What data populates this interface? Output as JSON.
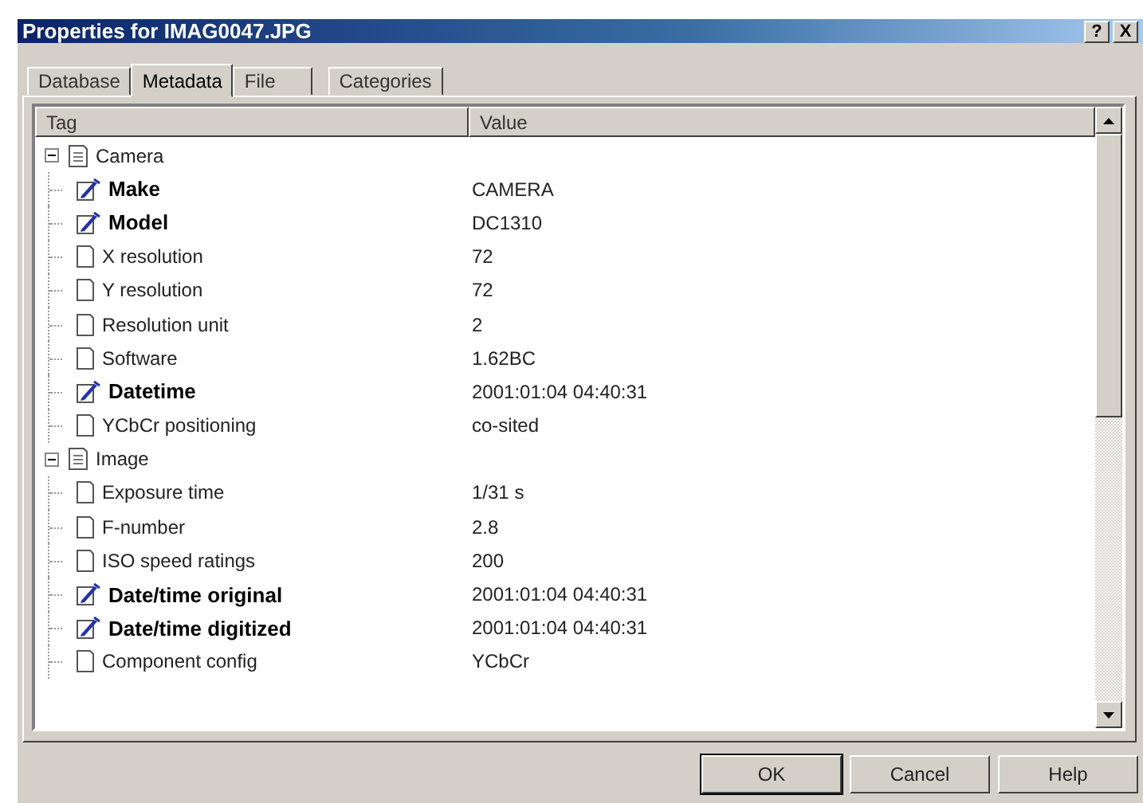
{
  "window": {
    "title": "Properties for IMAG0047.JPG",
    "help_glyph": "?",
    "close_glyph": "X"
  },
  "tabs": [
    {
      "label": "Database",
      "selected": false
    },
    {
      "label": "Metadata",
      "selected": true
    },
    {
      "label": "File",
      "selected": false
    },
    {
      "label": "Categories",
      "selected": false
    }
  ],
  "table": {
    "columns": [
      "Tag",
      "Value"
    ],
    "rows": [
      {
        "tag": "Camera",
        "expanded": true,
        "children": [
          {
            "tag": "Make",
            "value": "CAMERA",
            "modified": true
          },
          {
            "tag": "Model",
            "value": "DC1310",
            "modified": true
          },
          {
            "tag": "X resolution",
            "value": "72",
            "modified": false
          },
          {
            "tag": "Y resolution",
            "value": "72",
            "modified": false
          },
          {
            "tag": "Resolution unit",
            "value": "2",
            "modified": false
          },
          {
            "tag": "Software",
            "value": "1.62BC",
            "modified": false
          },
          {
            "tag": "Datetime",
            "value": "2001:01:04 04:40:31",
            "modified": true
          },
          {
            "tag": "YCbCr positioning",
            "value": "co-sited",
            "modified": false
          }
        ]
      },
      {
        "tag": "Image",
        "expanded": true,
        "children": [
          {
            "tag": "Exposure time",
            "value": "1/31 s",
            "modified": false
          },
          {
            "tag": "F-number",
            "value": "2.8",
            "modified": false
          },
          {
            "tag": "ISO speed ratings",
            "value": "200",
            "modified": false
          },
          {
            "tag": "Date/time original",
            "value": "2001:01:04 04:40:31",
            "modified": true
          },
          {
            "tag": "Date/time digitized",
            "value": "2001:01:04 04:40:31",
            "modified": true
          },
          {
            "tag": "Component config",
            "value": "YCbCr",
            "modified": false
          }
        ]
      }
    ]
  },
  "buttons": [
    {
      "label": "OK",
      "default": true
    },
    {
      "label": "Cancel",
      "default": false
    },
    {
      "label": "Help",
      "default": false
    }
  ]
}
